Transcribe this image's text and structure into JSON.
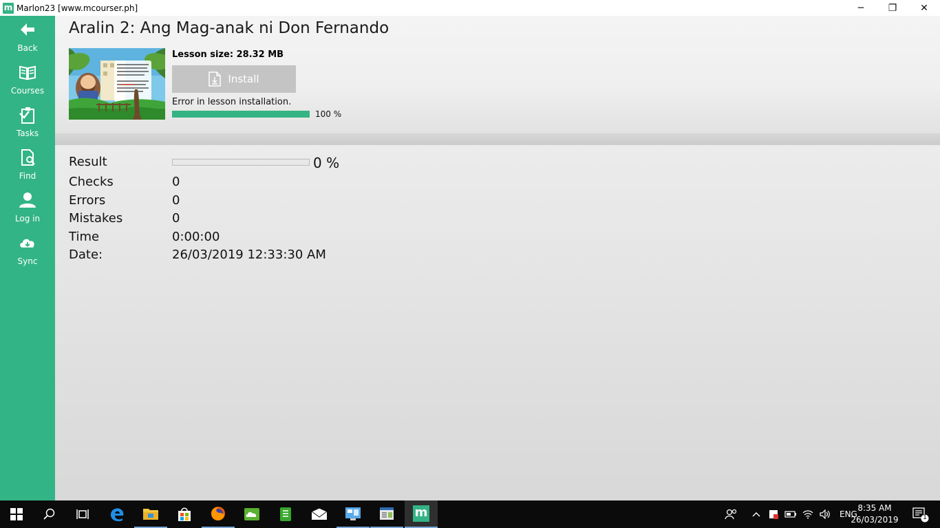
{
  "window": {
    "title": "Marlon23 [www.mcourser.ph]",
    "app_icon_letter": "m",
    "controls": {
      "minimize": "─",
      "restore": "❐",
      "close": "✕"
    }
  },
  "sidebar": {
    "items": [
      {
        "label": "Back",
        "icon": "arrow-left-icon"
      },
      {
        "label": "Courses",
        "icon": "book-icon"
      },
      {
        "label": "Tasks",
        "icon": "clipboard-icon"
      },
      {
        "label": "Find",
        "icon": "search-document-icon"
      },
      {
        "label": "Log in",
        "icon": "user-icon"
      },
      {
        "label": "Sync",
        "icon": "cloud-sync-icon"
      }
    ]
  },
  "lesson": {
    "title": "Aralin 2: Ang Mag-anak ni Don Fernando",
    "size_label": "Lesson size: 28.32 MB",
    "install_label": "Install",
    "status": "Error in lesson installation.",
    "progress_percent": 100,
    "progress_text": "100 %"
  },
  "results": {
    "result_label": "Result",
    "result_percent": 0,
    "result_text": "0 %",
    "checks_label": "Checks",
    "checks_value": "0",
    "errors_label": "Errors",
    "errors_value": "0",
    "mistakes_label": "Mistakes",
    "mistakes_value": "0",
    "time_label": "Time",
    "time_value": "0:00:00",
    "date_label": "Date:",
    "date_value": "26/03/2019 12:33:30 AM"
  },
  "taskbar": {
    "language": "ENG",
    "time": "8:35 AM",
    "date": "26/03/2019",
    "notification_count": "1",
    "pinned_app_letter": "m"
  },
  "colors": {
    "accent": "#33b486",
    "install_disabled": "#c4c4c4"
  }
}
